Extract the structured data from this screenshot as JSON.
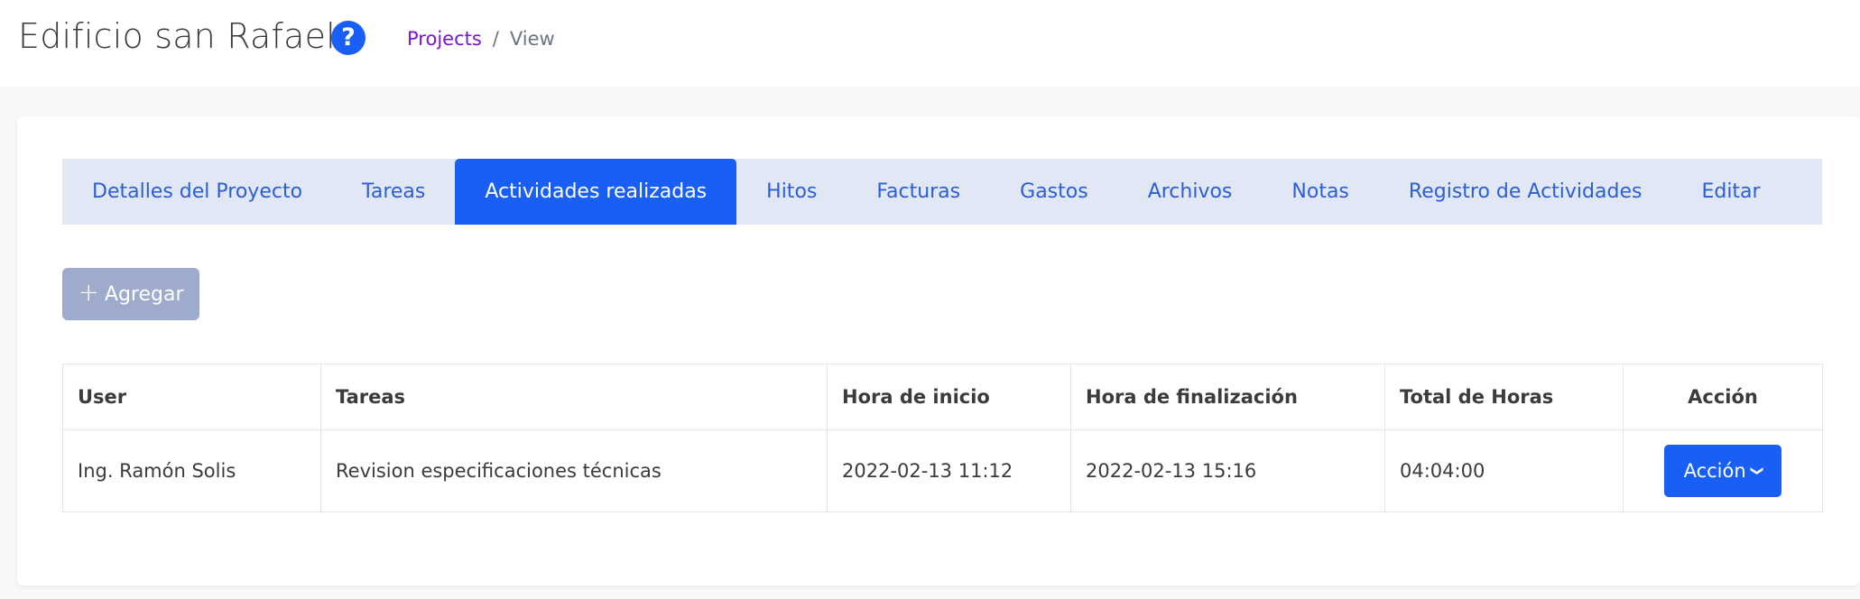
{
  "header": {
    "title": "Edificio san Rafael",
    "help_icon": "?",
    "breadcrumb": {
      "link": "Projects",
      "separator": "/",
      "current": "View"
    }
  },
  "tabs": [
    {
      "label": "Detalles del Proyecto",
      "active": false
    },
    {
      "label": "Tareas",
      "active": false
    },
    {
      "label": "Actividades realizadas",
      "active": true
    },
    {
      "label": "Hitos",
      "active": false
    },
    {
      "label": "Facturas",
      "active": false
    },
    {
      "label": "Gastos",
      "active": false
    },
    {
      "label": "Archivos",
      "active": false
    },
    {
      "label": "Notas",
      "active": false
    },
    {
      "label": "Registro de Actividades",
      "active": false
    },
    {
      "label": "Editar",
      "active": false
    }
  ],
  "toolbar": {
    "add_icon": "+",
    "add_label": "Agregar"
  },
  "table": {
    "columns": [
      "User",
      "Tareas",
      "Hora de inicio",
      "Hora de finalización",
      "Total de Horas",
      "Acción"
    ],
    "rows": [
      {
        "user": "Ing. Ramón Solis",
        "task": "Revision especificaciones técnicas",
        "start": "2022-02-13 11:12",
        "end": "2022-02-13 15:16",
        "total": "04:04:00",
        "action_label": "Acción"
      }
    ]
  },
  "colors": {
    "accent": "#1a5ff5",
    "tab_bar": "#e1e7f5",
    "tab_text": "#2b5fd6",
    "breadcrumb_link": "#7a14d6",
    "add_button": "#9eabcc"
  }
}
